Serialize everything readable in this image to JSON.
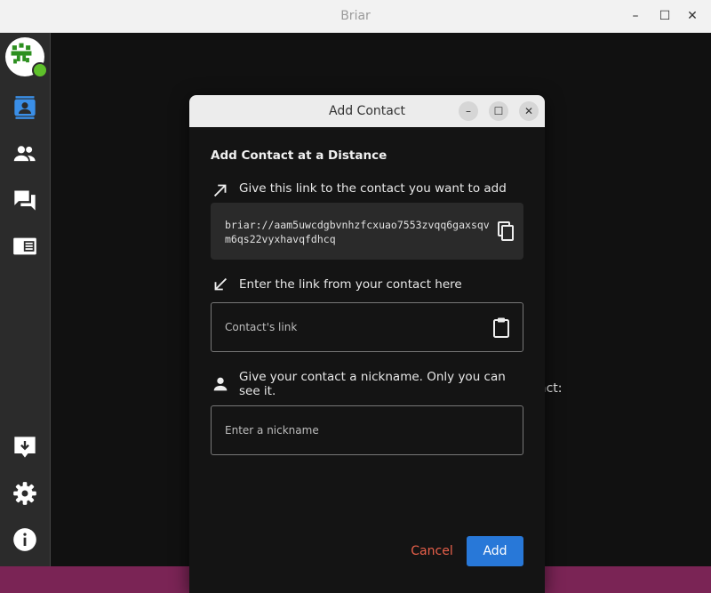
{
  "window": {
    "title": "Briar"
  },
  "background": {
    "partial_text": "act:"
  },
  "dialog": {
    "title": "Add Contact",
    "heading": "Add Contact at a Distance",
    "share_label": "Give this link to the contact you want to add",
    "my_link": "briar://aam5uwcdgbvnhzfcxuao7553zvqq6gaxsqvm6qs22vyxhavqfdhcq",
    "enter_label": "Enter the link from your contact here",
    "contact_link_placeholder": "Contact's link",
    "contact_link_value": "",
    "nickname_label": "Give your contact a nickname. Only you can see it.",
    "nickname_placeholder": "Enter a nickname",
    "nickname_value": "",
    "cancel_label": "Cancel",
    "add_label": "Add"
  },
  "colors": {
    "accent": "#2878d8",
    "cancel": "#e8604a",
    "status_online": "#5ec02a",
    "active_nav": "#3a8fe8"
  }
}
